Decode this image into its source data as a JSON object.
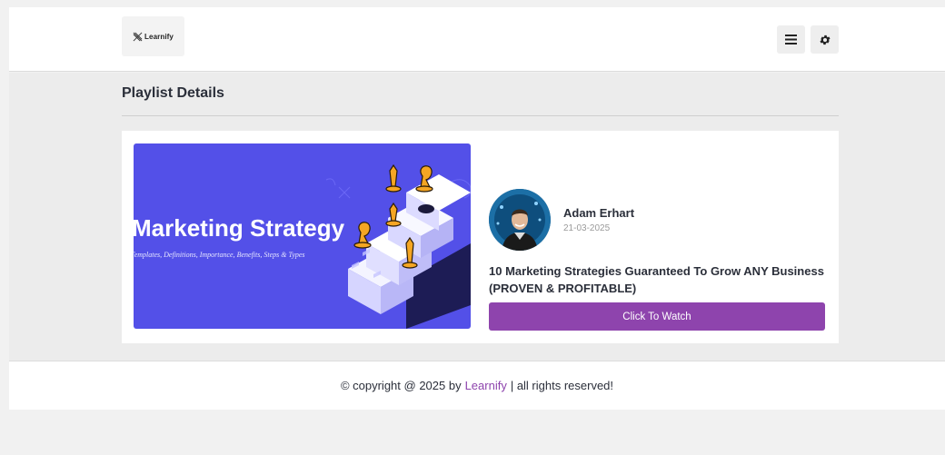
{
  "header": {
    "logo_text": "Learnify",
    "menu_icon": "hamburger-icon",
    "settings_icon": "gear-icon"
  },
  "main": {
    "page_title": "Playlist Details"
  },
  "playlist": {
    "thumbnail": {
      "title": "Marketing Strategy",
      "subtitle": "Templates, Definitions, Importance, Benefits, Steps & Types",
      "bg_color": "#5350e8"
    },
    "author_name": "Adam Erhart",
    "date": "21-03-2025",
    "video_title": "10 Marketing Strategies Guaranteed To Grow ANY Business (PROVEN & PROFITABLE)",
    "watch_label": "Click To Watch",
    "accent_color": "#8e44ad"
  },
  "footer": {
    "prefix": "© copyright @ 2025 by",
    "brand_link": "Learnify",
    "suffix": "| all rights reserved!"
  }
}
